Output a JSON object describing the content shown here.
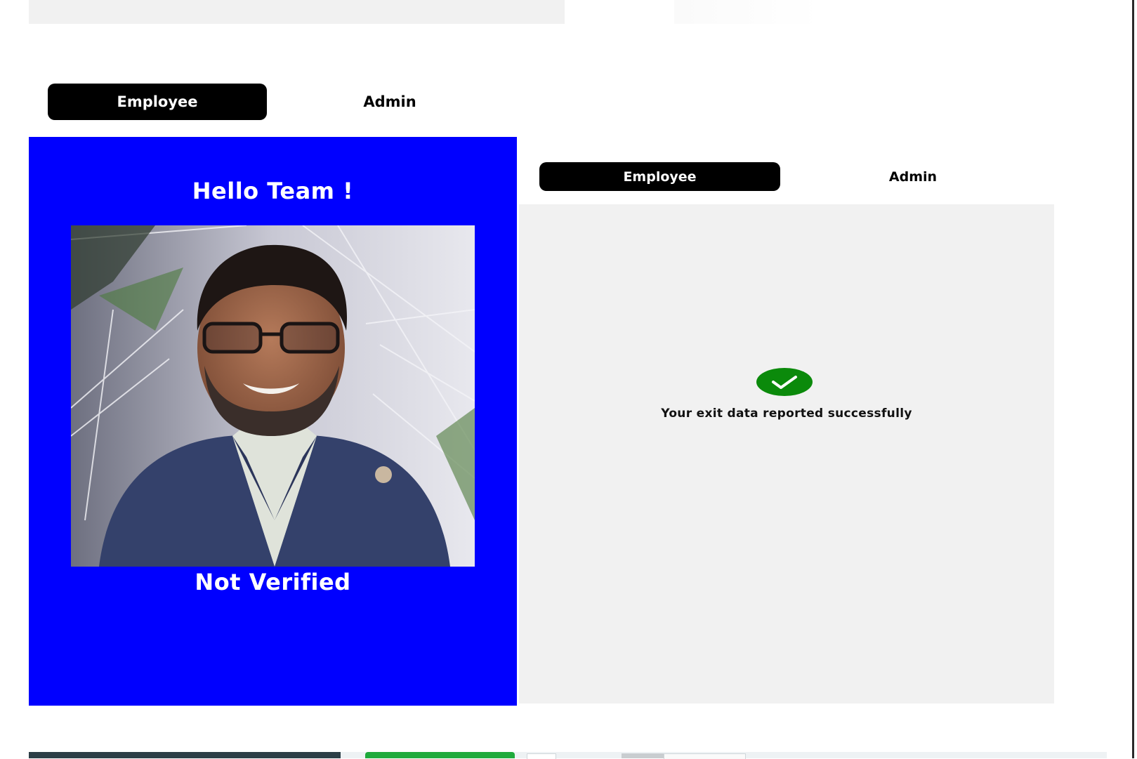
{
  "left_screen": {
    "tabs": [
      {
        "label": "Employee",
        "active": true
      },
      {
        "label": "Admin",
        "active": false
      }
    ],
    "greeting": "Hello Team !",
    "status": "Not Verified",
    "panel_color": "#0000ff"
  },
  "right_screen": {
    "tabs": [
      {
        "label": "Employee",
        "active": true
      },
      {
        "label": "Admin",
        "active": false
      }
    ],
    "message": "Your exit data reported successfully",
    "success_icon": "check-icon",
    "success_color": "#0b8a0b"
  }
}
